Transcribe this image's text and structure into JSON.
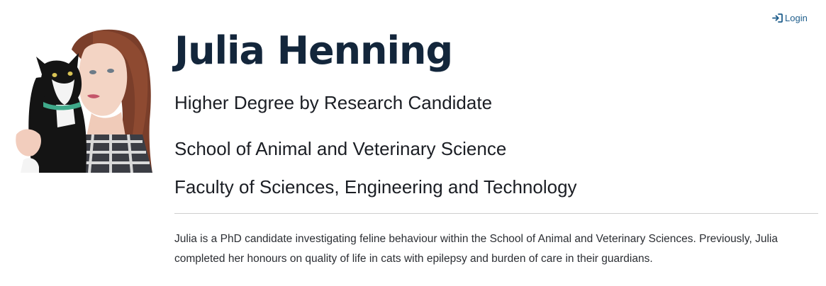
{
  "header": {
    "login_label": "Login",
    "login_icon": "sign-in-icon"
  },
  "profile": {
    "photo_alt": "Julia Henning",
    "name": "Julia Henning",
    "position": "Higher Degree by Research Candidate",
    "school": "School of Animal and Veterinary Science",
    "faculty": "Faculty of Sciences, Engineering and Technology",
    "bio": "Julia is a PhD candidate investigating feline behaviour within the School of Animal and Veterinary Sciences. Previously, Julia completed her honours on quality of life in cats with epilepsy and burden of care in their guardians."
  },
  "colors": {
    "name": "#13263b",
    "link": "#1f5e8c",
    "divider": "#cfcfcf"
  }
}
